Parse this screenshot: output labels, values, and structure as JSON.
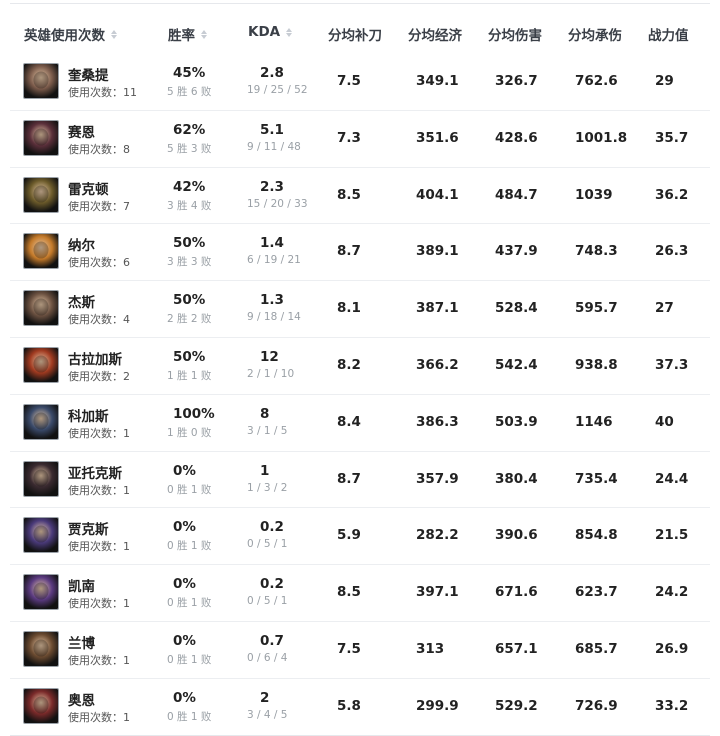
{
  "headers": [
    "英雄使用次数",
    "胜率",
    "KDA",
    "分均补刀",
    "分均经济",
    "分均伤害",
    "分均承伤",
    "战力值"
  ],
  "rows": [
    {
      "hero": "奎桑提",
      "uses": "使用次数：11",
      "win_rate": "45%",
      "wl": "5 胜 6 败",
      "kda": "2.8",
      "kda_detail": "19 / 25 / 52",
      "cs": "7.5",
      "gold": "349.1",
      "damage": "326.7",
      "taken": "762.6",
      "power": "29",
      "color": "#7a5a4a"
    },
    {
      "hero": "赛恩",
      "uses": "使用次数：8",
      "win_rate": "62%",
      "wl": "5 胜 3 败",
      "kda": "5.1",
      "kda_detail": "9 / 11 / 48",
      "cs": "7.3",
      "gold": "351.6",
      "damage": "428.6",
      "taken": "1001.8",
      "power": "35.7",
      "color": "#5a2f3a"
    },
    {
      "hero": "雷克顿",
      "uses": "使用次数：7",
      "win_rate": "42%",
      "wl": "3 胜 4 败",
      "kda": "2.3",
      "kda_detail": "15 / 20 / 33",
      "cs": "8.5",
      "gold": "404.1",
      "damage": "484.7",
      "taken": "1039",
      "power": "36.2",
      "color": "#6b5a2a"
    },
    {
      "hero": "纳尔",
      "uses": "使用次数：6",
      "win_rate": "50%",
      "wl": "3 胜 3 败",
      "kda": "1.4",
      "kda_detail": "6 / 19 / 21",
      "cs": "8.7",
      "gold": "389.1",
      "damage": "437.9",
      "taken": "748.3",
      "power": "26.3",
      "color": "#c47a2a"
    },
    {
      "hero": "杰斯",
      "uses": "使用次数：4",
      "win_rate": "50%",
      "wl": "2 胜 2 败",
      "kda": "1.3",
      "kda_detail": "9 / 18 / 14",
      "cs": "8.1",
      "gold": "387.1",
      "damage": "528.4",
      "taken": "595.7",
      "power": "27",
      "color": "#6a5040"
    },
    {
      "hero": "古拉加斯",
      "uses": "使用次数：2",
      "win_rate": "50%",
      "wl": "1 胜 1 败",
      "kda": "12",
      "kda_detail": "2 / 1 / 10",
      "cs": "8.2",
      "gold": "366.2",
      "damage": "542.4",
      "taken": "938.8",
      "power": "37.3",
      "color": "#a03a20"
    },
    {
      "hero": "科加斯",
      "uses": "使用次数：1",
      "win_rate": "100%",
      "wl": "1 胜 0 败",
      "kda": "8",
      "kda_detail": "3 / 1 / 5",
      "cs": "8.4",
      "gold": "386.3",
      "damage": "503.9",
      "taken": "1146",
      "power": "40",
      "color": "#3a4a6a"
    },
    {
      "hero": "亚托克斯",
      "uses": "使用次数：1",
      "win_rate": "0%",
      "wl": "0 胜 1 败",
      "kda": "1",
      "kda_detail": "1 / 3 / 2",
      "cs": "8.7",
      "gold": "357.9",
      "damage": "380.4",
      "taken": "735.4",
      "power": "24.4",
      "color": "#3a2a30"
    },
    {
      "hero": "贾克斯",
      "uses": "使用次数：1",
      "win_rate": "0%",
      "wl": "0 胜 1 败",
      "kda": "0.2",
      "kda_detail": "0 / 5 / 1",
      "cs": "5.9",
      "gold": "282.2",
      "damage": "390.6",
      "taken": "854.8",
      "power": "21.5",
      "color": "#4a3a7a"
    },
    {
      "hero": "凯南",
      "uses": "使用次数：1",
      "win_rate": "0%",
      "wl": "0 胜 1 败",
      "kda": "0.2",
      "kda_detail": "0 / 5 / 1",
      "cs": "8.5",
      "gold": "397.1",
      "damage": "671.6",
      "taken": "623.7",
      "power": "24.2",
      "color": "#5a3a80"
    },
    {
      "hero": "兰博",
      "uses": "使用次数：1",
      "win_rate": "0%",
      "wl": "0 胜 1 败",
      "kda": "0.7",
      "kda_detail": "0 / 6 / 4",
      "cs": "7.5",
      "gold": "313",
      "damage": "657.1",
      "taken": "685.7",
      "power": "26.9",
      "color": "#6a4a30"
    },
    {
      "hero": "奥恩",
      "uses": "使用次数：1",
      "win_rate": "0%",
      "wl": "0 胜 1 败",
      "kda": "2",
      "kda_detail": "3 / 4 / 5",
      "cs": "5.8",
      "gold": "299.9",
      "damage": "529.2",
      "taken": "726.9",
      "power": "33.2",
      "color": "#7a2a2a"
    }
  ]
}
